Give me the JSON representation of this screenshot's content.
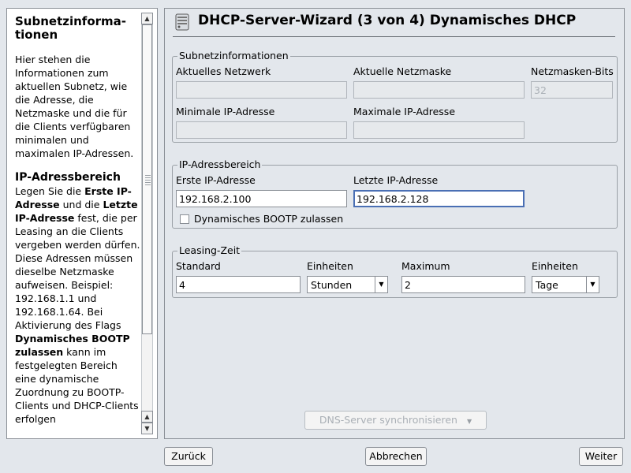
{
  "help": {
    "title": "Subnetzinforma-tionen",
    "intro": "Hier stehen die Informationen zum aktuellen Subnetz, wie die Adresse, die Netzmaske und die für die Clients verfügbaren minimalen und maximalen IP-Adressen.",
    "section_heading": "IP-Adressbereich",
    "body_1": "Legen Sie die ",
    "bold_1": "Erste IP-Adresse",
    "body_2": " und die ",
    "bold_2": "Letzte IP-Adresse",
    "body_3": " fest, die per Leasing an die Clients vergeben werden dürfen. Diese Adressen müssen dieselbe Netzmaske aufweisen. Beispiel: 192.168.1.1 und 192.168.1.64. Bei Aktivierung des Flags ",
    "bold_3": "Dynamisches BOOTP zulassen",
    "body_4": " kann im festgelegten Bereich eine dynamische Zuordnung zu BOOTP-Clients und DHCP-Clients erfolgen"
  },
  "wizard": {
    "title": "DHCP-Server-Wizard (3 von 4) Dynamisches DHCP"
  },
  "subnet": {
    "legend": "Subnetzinformationen",
    "current_network_label": "Aktuelles Netzwerk",
    "current_network_value": "",
    "current_netmask_label": "Aktuelle Netzmaske",
    "current_netmask_value": "",
    "netmask_bits_label": "Netzmasken-Bits",
    "netmask_bits_value": "32",
    "min_ip_label": "Minimale IP-Adresse",
    "min_ip_value": "",
    "max_ip_label": "Maximale IP-Adresse",
    "max_ip_value": ""
  },
  "range": {
    "legend": "IP-Adressbereich",
    "first_ip_label": "Erste IP-Adresse",
    "first_ip_value": "192.168.2.100",
    "last_ip_label": "Letzte IP-Adresse",
    "last_ip_value": "192.168.2.128",
    "bootp_label": "Dynamisches BOOTP zulassen",
    "bootp_checked": false
  },
  "lease": {
    "legend": "Leasing-Zeit",
    "standard_label": "Standard",
    "standard_value": "4",
    "units_label_1": "Einheiten",
    "units_value_1": "Stunden",
    "maximum_label": "Maximum",
    "maximum_value": "2",
    "units_label_2": "Einheiten",
    "units_value_2": "Tage"
  },
  "dns_sync_label": "DNS-Server synchronisieren",
  "buttons": {
    "back": "Zurück",
    "abort": "Abbrechen",
    "next": "Weiter"
  }
}
